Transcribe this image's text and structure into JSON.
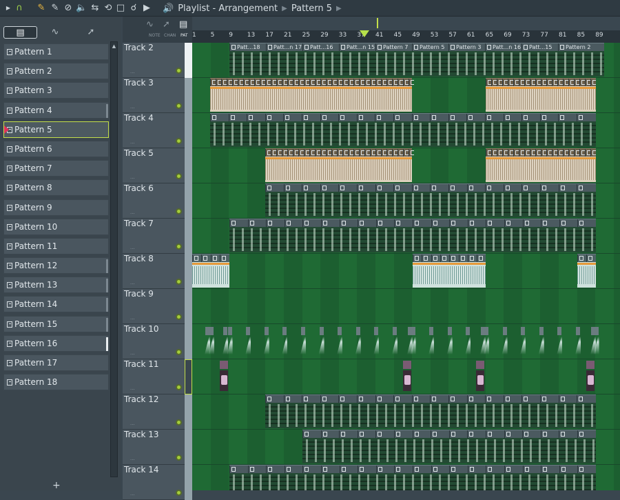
{
  "toolbar": {
    "title": "Playlist - Arrangement",
    "pattern": "Pattern 5",
    "icons": [
      "play-icon",
      "magnet-icon",
      "pencil-icon",
      "paint-icon",
      "delete-icon",
      "mute-icon",
      "slip-icon",
      "slice-icon",
      "select-icon",
      "zoom-icon",
      "playback-icon",
      "speaker-icon"
    ]
  },
  "browser": {
    "tabs": [
      "pattern-tab",
      "audio-tab",
      "automation-tab"
    ],
    "add_label": "+"
  },
  "patterns": [
    "Pattern 1",
    "Pattern 2",
    "Pattern 3",
    "Pattern 4",
    "Pattern 5",
    "Pattern 6",
    "Pattern 7",
    "Pattern 8",
    "Pattern 9",
    "Pattern 10",
    "Pattern 11",
    "Pattern 12",
    "Pattern 13",
    "Pattern 14",
    "Pattern 15",
    "Pattern 16",
    "Pattern 17",
    "Pattern 18"
  ],
  "selected_pattern": 5,
  "track_header": {
    "labels": [
      "NOTE",
      "CHAN",
      "PAT"
    ]
  },
  "ruler": {
    "ticks": [
      "1",
      "5",
      "9",
      "13",
      "17",
      "21",
      "25",
      "29",
      "33",
      "37",
      "41",
      "45",
      "49",
      "53",
      "57",
      "61",
      "65",
      "69",
      "73",
      "77",
      "81",
      "85",
      "89"
    ]
  },
  "tracks": [
    "Track 2",
    "Track 3",
    "Track 4",
    "Track 5",
    "Track 6",
    "Track 7",
    "Track 8",
    "Track 9",
    "Track 10",
    "Track 11",
    "Track 12",
    "Track 13",
    "Track 14"
  ],
  "track2_clips": [
    "Patt...18",
    "Patt...n 17",
    "Patt...16",
    "Patt...n 15",
    "Pattern 7",
    "Pattern 5",
    "Pattern 3",
    "Patt...n 16",
    "Patt...15",
    "Pattern 2"
  ],
  "colors": {
    "accent": "#c5e04a",
    "grid_green": "#1f6a34",
    "selected_marker": "#e0305b"
  }
}
